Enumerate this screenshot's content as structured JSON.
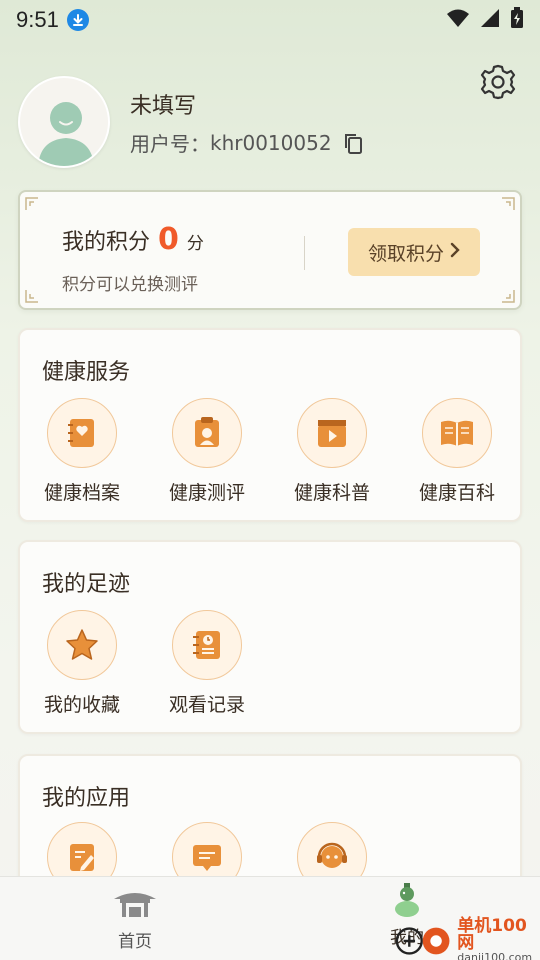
{
  "status_bar": {
    "time": "9:51"
  },
  "profile": {
    "name": "未填写",
    "user_id_label": "用户号：",
    "user_id": "khr0010052"
  },
  "points": {
    "title": "我的积分",
    "value": "0",
    "unit": "分",
    "description": "积分可以兑换测评",
    "claim_label": "领取积分"
  },
  "health_services": {
    "title": "健康服务",
    "items": [
      {
        "label": "健康档案",
        "icon": "health-record-icon"
      },
      {
        "label": "健康测评",
        "icon": "health-assessment-icon"
      },
      {
        "label": "健康科普",
        "icon": "health-video-icon"
      },
      {
        "label": "健康百科",
        "icon": "health-encyclopedia-icon"
      }
    ]
  },
  "footprints": {
    "title": "我的足迹",
    "items": [
      {
        "label": "我的收藏",
        "icon": "star-icon"
      },
      {
        "label": "观看记录",
        "icon": "watch-history-icon"
      }
    ]
  },
  "my_apps": {
    "title": "我的应用",
    "items": [
      {
        "label": "",
        "icon": "edit-note-icon"
      },
      {
        "label": "",
        "icon": "message-icon"
      },
      {
        "label": "",
        "icon": "customer-service-icon"
      }
    ]
  },
  "bottom_nav": {
    "home_label": "首页",
    "mine_label": "我的"
  },
  "watermark": {
    "cn": "单机100网",
    "en": "danji100.com"
  },
  "colors": {
    "accent_orange": "#f05a2a",
    "icon_orange": "#e8903a",
    "claim_button": "#f8dfae"
  }
}
